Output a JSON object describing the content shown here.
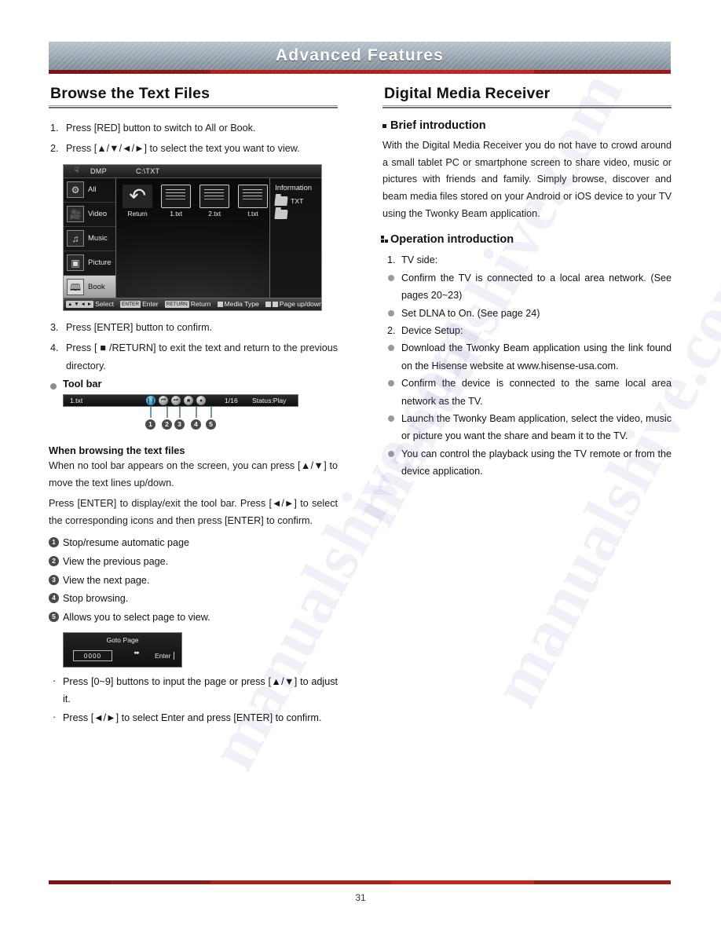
{
  "banner": {
    "title": "Advanced Features"
  },
  "left": {
    "heading": "Browse the Text Files",
    "steps": [
      {
        "num": "1.",
        "text": "Press [RED] button to switch to All or Book."
      },
      {
        "num": "2.",
        "text": "Press [▲/▼/◄/►] to select the text you want to view."
      },
      {
        "num": "3.",
        "text": "Press [ENTER] button to confirm."
      },
      {
        "num": "4.",
        "text": "Press [ ■ /RETURN] to exit the text and return to the previous directory."
      }
    ],
    "tv_screenshot": {
      "topbar": {
        "plug_icon": "usb-plug-icon",
        "source": "DMP",
        "path": "C:\\TXT"
      },
      "sidebar": [
        {
          "label": "All",
          "icon": "all-media-icon",
          "selected": false
        },
        {
          "label": "Video",
          "icon": "video-icon",
          "selected": false
        },
        {
          "label": "Music",
          "icon": "music-note-icon",
          "selected": false
        },
        {
          "label": "Picture",
          "icon": "picture-icon",
          "selected": false
        },
        {
          "label": "Book",
          "icon": "book-icon",
          "selected": true
        }
      ],
      "files": [
        {
          "label": "Return",
          "type": "return"
        },
        {
          "label": "1.txt",
          "type": "doc"
        },
        {
          "label": "2.txt",
          "type": "doc"
        },
        {
          "label": "t.txt",
          "type": "doc"
        }
      ],
      "info": {
        "title": "Information",
        "rows": [
          {
            "label": "TXT",
            "icon": "folder-icon"
          },
          {
            "label": "",
            "icon": "folder-icon"
          }
        ]
      },
      "bottombar": [
        {
          "key": "▲ ▼ ◄ ►",
          "label": "Select",
          "key_type": "arrows"
        },
        {
          "key": "ENTER",
          "label": "Enter",
          "key_type": "text"
        },
        {
          "key": "RETURN",
          "label": "Return",
          "key_type": "text"
        },
        {
          "key": "■",
          "label": "Media Type",
          "key_type": "square"
        },
        {
          "key": "■ ■",
          "label": "Page up/down",
          "key_type": "square2"
        }
      ]
    },
    "toolbar_label": "Tool bar",
    "toolbar_fig": {
      "filename": "1.txt",
      "page": "1/16",
      "status": "Status:Play",
      "icons": [
        {
          "name": "pause-resume-icon",
          "glyph": "‖",
          "accent": "#2f9fd4"
        },
        {
          "name": "previous-page-icon",
          "glyph": "⏮"
        },
        {
          "name": "next-page-icon",
          "glyph": "⏭"
        },
        {
          "name": "stop-icon",
          "glyph": "■"
        },
        {
          "name": "goto-page-icon",
          "glyph": "⬤"
        }
      ],
      "callouts": [
        "1",
        "2",
        "3",
        "4",
        "5"
      ]
    },
    "browsing": {
      "heading": "When browsing the text files",
      "paragraphs": [
        "When no tool bar appears on the screen, you can press [▲/▼] to move the text lines up/down.",
        "Press [ENTER] to display/exit the tool bar. Press [◄/►] to select the corresponding icons and then press [ENTER] to confirm."
      ],
      "items": [
        {
          "n": "1",
          "text": "Stop/resume automatic page"
        },
        {
          "n": "2",
          "text": "View the previous page."
        },
        {
          "n": "3",
          "text": "View the next page."
        },
        {
          "n": "4",
          "text": "Stop browsing."
        },
        {
          "n": "5",
          "text": "Allows you to select page to view."
        }
      ]
    },
    "goto_dialog": {
      "title": "Goto Page",
      "input_value": "0000",
      "pad_icon": "dpad-icon",
      "enter_label": "Enter"
    },
    "goto_notes": [
      "Press [0~9] buttons to input the page or press [▲/▼] to adjust it.",
      "Press [◄/►] to select Enter and press [ENTER] to confirm."
    ]
  },
  "right": {
    "heading": "Digital Media Receiver",
    "brief_heading": "Brief introduction",
    "brief_text": "With the Digital Media Receiver you do not have to crowd around a small tablet PC or smartphone screen to share video, music or pictures with friends and family.  Simply browse, discover and beam media files stored on your Android or iOS device to your TV using the Twonky Beam application.",
    "operation_heading": "Operation introduction",
    "operation_items": [
      {
        "kind": "step",
        "num": "1.",
        "text": "TV side:"
      },
      {
        "kind": "bullet",
        "text": "Confirm the TV is connected to a local area network. (See pages 20~23)"
      },
      {
        "kind": "bullet",
        "text": "Set DLNA to On. (See page 24)"
      },
      {
        "kind": "step",
        "num": "2.",
        "text": "Device Setup:"
      },
      {
        "kind": "bullet",
        "text": "Download the Twonky Beam application using the link found on the Hisense website at www.hisense-usa.com."
      },
      {
        "kind": "bullet",
        "text": "Confirm the device is connected to the same local area network as the TV."
      },
      {
        "kind": "bullet",
        "text": "Launch the Twonky Beam application, select the video, music or picture you want the share and beam it to the TV."
      },
      {
        "kind": "bullet",
        "text": "You can control the playback using the TV remote or from the device application."
      }
    ]
  },
  "footer": {
    "page_number": "31"
  },
  "watermark": {
    "text": "manualshive.com"
  },
  "colors": {
    "accent_red": "#b31f18",
    "banner_gray": "#9fabb6",
    "rule_gray": "#6f6f6f",
    "bullet_gray": "#9a9a9a",
    "callout_dark": "#4a4a4a"
  }
}
